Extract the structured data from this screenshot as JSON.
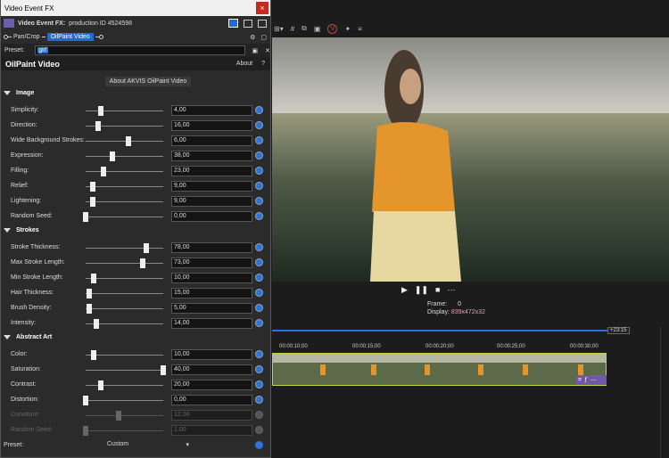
{
  "window": {
    "title": "Video Event FX",
    "close_label": "×"
  },
  "fx_header": {
    "label": "Video Event FX:",
    "value": "production ID 4524598"
  },
  "chain": {
    "items": [
      "Pan/Crop",
      "OilPaint Video"
    ]
  },
  "preset_row": {
    "label": "Preset:",
    "value": "girl"
  },
  "plugin": {
    "title": "OilPaint Video",
    "about_label": "About",
    "help_label": "?",
    "about_link": "About AKVIS OilPaint Video"
  },
  "sections": [
    {
      "name": "Image",
      "params": [
        {
          "name": "Simplicity:",
          "value": "4,00",
          "fraction": 0.2
        },
        {
          "name": "Direction:",
          "value": "16,00",
          "fraction": 0.16
        },
        {
          "name": "Wide Background Strokes:",
          "value": "6,00",
          "fraction": 0.55
        },
        {
          "name": "Expression:",
          "value": "38,00",
          "fraction": 0.35
        },
        {
          "name": "Filling:",
          "value": "23,00",
          "fraction": 0.23
        },
        {
          "name": "Relief:",
          "value": "9,00",
          "fraction": 0.09
        },
        {
          "name": "Lightening:",
          "value": "9,00",
          "fraction": 0.09
        },
        {
          "name": "Random Seed:",
          "value": "0,00",
          "fraction": 0.0
        }
      ]
    },
    {
      "name": "Strokes",
      "params": [
        {
          "name": "Stroke Thickness:",
          "value": "78,00",
          "fraction": 0.78
        },
        {
          "name": "Max Stroke Length:",
          "value": "73,00",
          "fraction": 0.73
        },
        {
          "name": "Min Stroke Length:",
          "value": "10,00",
          "fraction": 0.1
        },
        {
          "name": "Hair Thickness:",
          "value": "15,00",
          "fraction": 0.05
        },
        {
          "name": "Brush Density:",
          "value": "5,00",
          "fraction": 0.05
        },
        {
          "name": "Intensity:",
          "value": "14,00",
          "fraction": 0.14
        }
      ]
    },
    {
      "name": "Abstract Art",
      "params": [
        {
          "name": "Color:",
          "value": "10,00",
          "fraction": 0.1
        },
        {
          "name": "Saturation:",
          "value": "40,00",
          "fraction": 1.0
        },
        {
          "name": "Contrast:",
          "value": "20,00",
          "fraction": 0.2
        },
        {
          "name": "Distortion:",
          "value": "0,00",
          "fraction": 0.0
        },
        {
          "name": "Curvature:",
          "value": "12,00",
          "fraction": 0.43,
          "disabled": true
        },
        {
          "name": "Random Seed:",
          "value": "1,00",
          "fraction": 0.0,
          "disabled": true
        }
      ]
    }
  ],
  "bottom_preset": {
    "label": "Preset:",
    "value": "Custom"
  },
  "preview": {
    "frame_label": "Frame:",
    "frame_value": "0",
    "display_label": "Display:",
    "display_value": "839x472x32"
  },
  "timeline": {
    "tag": "+23:15",
    "ticks": [
      "00:00:10;00",
      "00:00:15;00",
      "00:00:20;00",
      "00:00:25;00",
      "00:00:30;00"
    ]
  },
  "colors": {
    "accent": "#1f6ad6",
    "close": "#c42b1c",
    "clip_border": "#c8d040"
  }
}
